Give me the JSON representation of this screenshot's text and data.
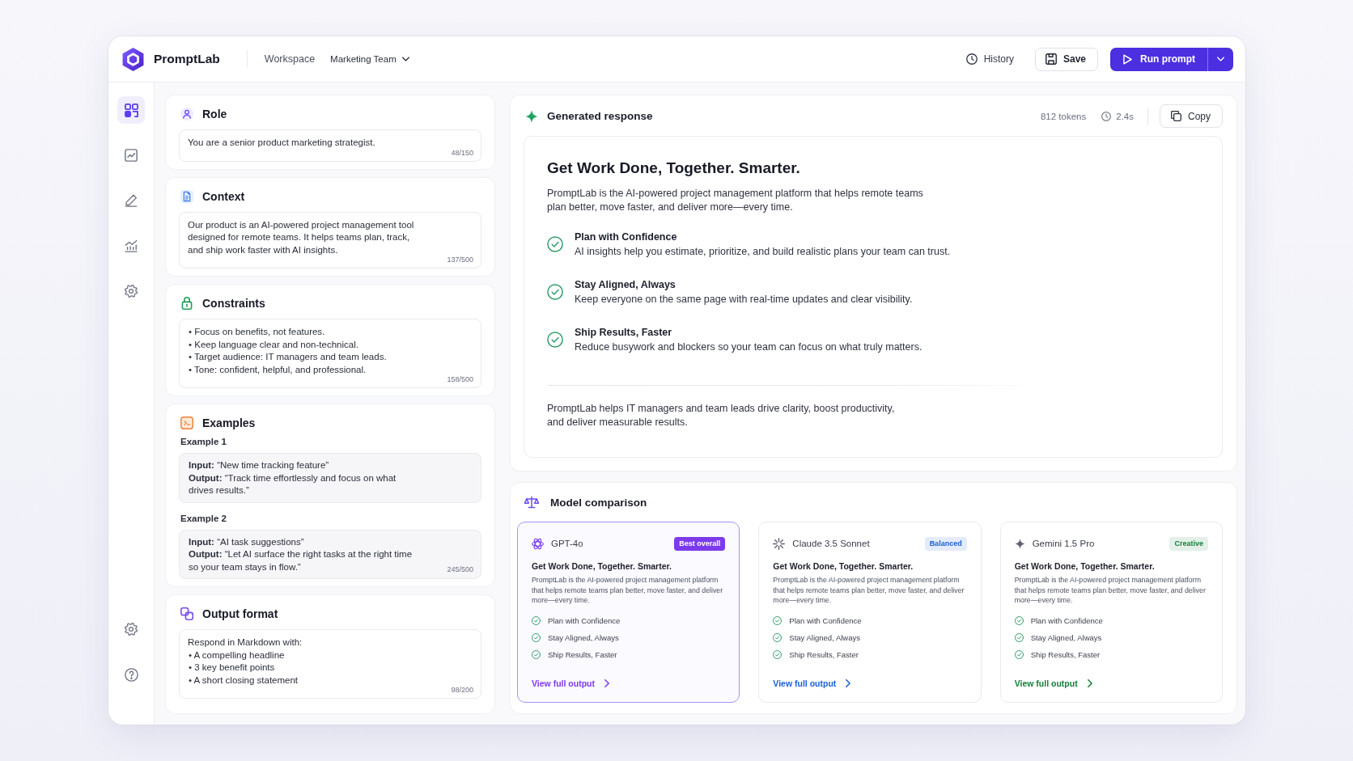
{
  "app": {
    "name": "PromptLab"
  },
  "top_bar": {
    "workspace": "Workspace",
    "team": "Marketing Team",
    "actions": [
      {
        "kind": "ghost",
        "label": "History"
      },
      {
        "kind": "outline",
        "label": "Save"
      },
      {
        "kind": "primary",
        "label": "Run prompt"
      }
    ]
  },
  "sidebar": {
    "top_items": [
      {
        "selected": true
      },
      {
        "selected": false
      },
      {
        "selected": false
      },
      {
        "selected": false
      },
      {
        "selected": false
      }
    ],
    "bottom_items": [
      {
        "selected": false
      },
      {
        "selected": false
      }
    ]
  },
  "prompt_sections": [
    {
      "kind": "text",
      "title": "Role",
      "text": "You are a senior product marketing strategist.",
      "count": "48/150"
    },
    {
      "kind": "text",
      "title": "Context",
      "text": "Our product is an AI-powered project management tool designed for remote teams. It helps teams plan, track, and ship work faster with AI insights.",
      "count": "137/500"
    },
    {
      "kind": "list",
      "title": "Constraints",
      "items": [
        "• Focus on benefits, not features.",
        "• Keep language clear and non-technical.",
        "• Target audience: IT managers and team leads.",
        "• Tone: confident, helpful, and professional."
      ],
      "count": "158/500"
    },
    {
      "kind": "examples",
      "title": "Examples",
      "examples": [
        {
          "label": "Example 1",
          "input": "**Input:** “New time tracking feature”",
          "output": "**Output:** “Track time effortlessly and focus on what drives results.”"
        },
        {
          "label": "Example 2",
          "input": "**Input:** “AI task suggestions”",
          "output": "**Output:** “Let AI surface the right tasks at the right time so your team stays in flow.”"
        }
      ],
      "count": "245/500"
    },
    {
      "kind": "list",
      "title": "Output format",
      "intro": "Respond in Markdown with:",
      "items": [
        "• A compelling headline",
        "• 3 key benefit points",
        "• A short closing statement"
      ],
      "count": "98/200"
    }
  ],
  "response": {
    "title": "Generated response",
    "tokens": "812 tokens",
    "duration": "2.4s",
    "copy_label": "Copy",
    "headline": "Get Work Done, Together. Smarter.",
    "intro": "PromptLab is the AI-powered project management platform that helps remote teams plan better, move faster, and deliver more—every time.",
    "benefits": [
      {
        "title": "Plan with Confidence",
        "text": "AI insights help you estimate, prioritize, and build realistic plans your team can trust."
      },
      {
        "title": "Stay Aligned, Always",
        "text": "Keep everyone on the same page with real-time updates and clear visibility."
      },
      {
        "title": "Ship Results, Faster",
        "text": "Reduce busywork and blockers so your team can focus on what truly matters."
      }
    ],
    "closing": "PromptLab helps IT managers and team leads drive clarity, boost productivity, and deliver measurable results."
  },
  "comparison": {
    "title": "Model comparison",
    "models": [
      {
        "name": "GPT-4o",
        "badge": "Best overall",
        "color": "#7c3aed",
        "selected": true,
        "headline": "Get Work Done, Together. Smarter.",
        "text": "PromptLab is the AI-powered project management platform that helps remote teams plan better, move faster, and deliver more—every time.",
        "points": [
          "Plan with Confidence",
          "Stay Aligned, Always",
          "Ship Results, Faster"
        ],
        "link": "View full output"
      },
      {
        "name": "Claude 3.5 Sonnet",
        "badge": "Balanced",
        "color": "#1d5fd6",
        "selected": false,
        "headline": "Get Work Done, Together. Smarter.",
        "text": "PromptLab is the AI-powered project management platform that helps remote teams plan better, move faster, and deliver more—every time.",
        "points": [
          "Plan with Confidence",
          "Stay Aligned, Always",
          "Ship Results, Faster"
        ],
        "link": "View full output"
      },
      {
        "name": "Gemini 1.5 Pro",
        "badge": "Creative",
        "color": "#15803d",
        "selected": false,
        "headline": "Get Work Done, Together. Smarter.",
        "text": "PromptLab is the AI-powered project management platform that helps remote teams plan better, move faster, and deliver more—every time.",
        "points": [
          "Plan with Confidence",
          "Stay Aligned, Always",
          "Ship Results, Faster"
        ],
        "link": "View full output"
      }
    ]
  }
}
